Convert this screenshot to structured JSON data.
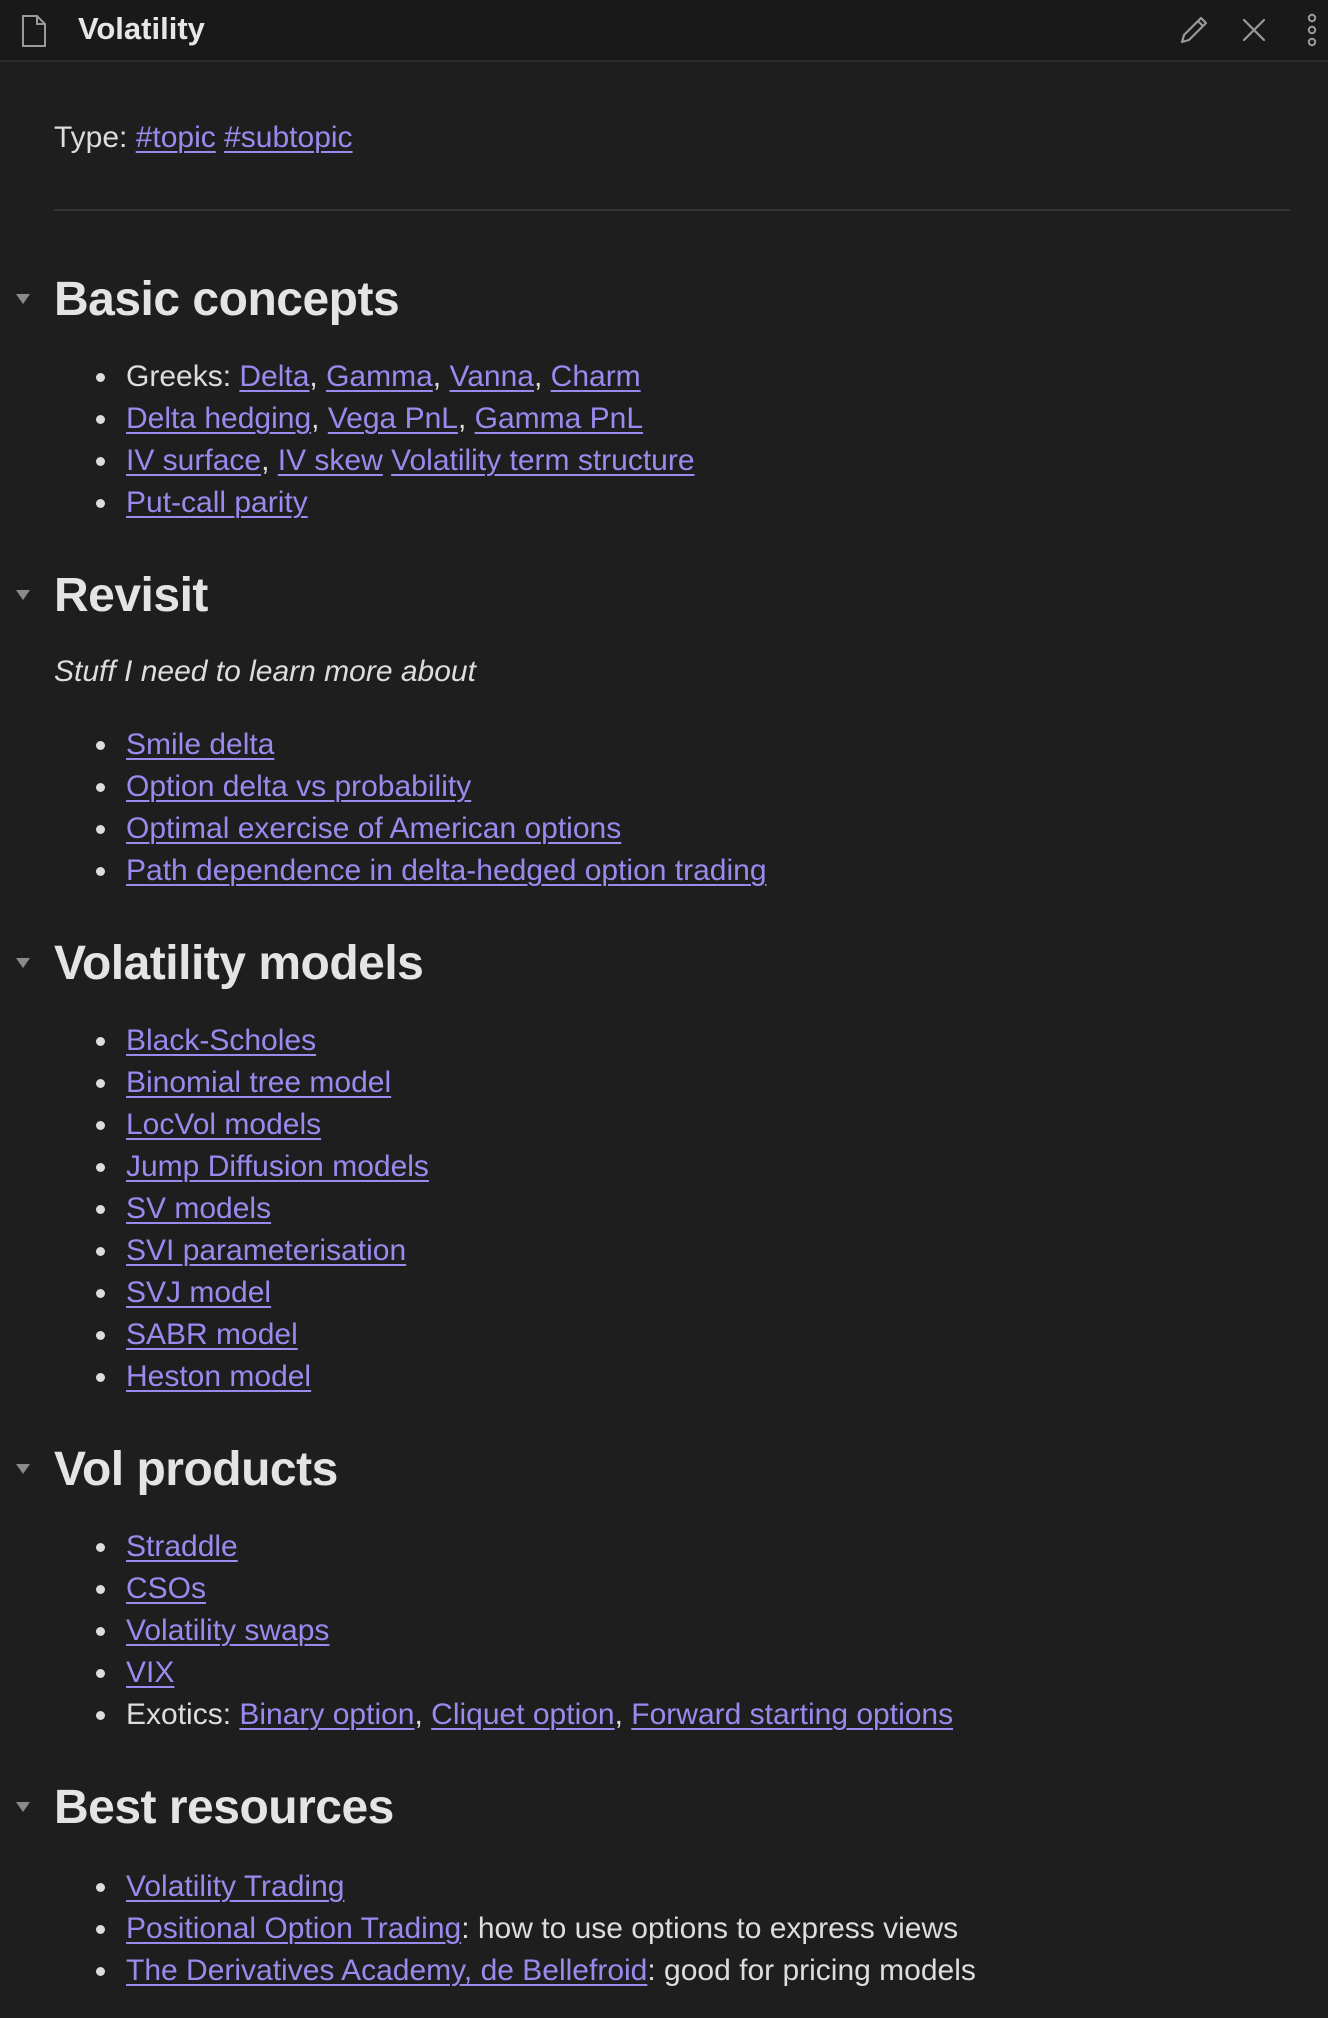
{
  "window": {
    "title": "Volatility",
    "icons": [
      "file-icon",
      "pencil-icon",
      "close-icon",
      "more-vertical-icon"
    ]
  },
  "meta": {
    "label": "Type:",
    "tags": [
      "#topic",
      "#subtopic"
    ]
  },
  "sections": {
    "basic": {
      "heading": "Basic concepts",
      "greeks_label": "Greeks:",
      "greeks": [
        "Delta",
        "Gamma",
        "Vanna",
        "Charm"
      ],
      "hedging": [
        "Delta hedging",
        "Vega PnL",
        "Gamma PnL"
      ],
      "surface": [
        "IV surface",
        "IV skew",
        "Volatility term structure"
      ],
      "parity": "Put-call parity"
    },
    "revisit": {
      "heading": "Revisit",
      "subtitle": "Stuff I need to learn more about",
      "items": [
        "Smile delta",
        "Option delta vs probability",
        "Optimal exercise of American options",
        "Path dependence in delta-hedged option trading"
      ]
    },
    "models": {
      "heading": "Volatility models",
      "items": [
        "Black-Scholes",
        "Binomial tree model",
        "LocVol models",
        "Jump Diffusion models",
        "SV models",
        "SVI parameterisation",
        "SVJ model",
        "SABR model",
        "Heston model"
      ]
    },
    "products": {
      "heading": "Vol products",
      "items": [
        "Straddle",
        "CSOs",
        "Volatility swaps",
        "VIX"
      ],
      "exotics_label": "Exotics:",
      "exotics": [
        "Binary option",
        "Cliquet option",
        "Forward starting options"
      ]
    },
    "resources": {
      "heading": "Best resources",
      "r1_link": "Volatility Trading",
      "r2_link": "Positional Option Trading",
      "r2_note": ": how to use options to express views",
      "r3_link": "The Derivatives Academy, de Bellefroid",
      "r3_note": ": good for pricing models"
    }
  },
  "colors": {
    "background": "#1e1e1e",
    "link": "#9b8aee",
    "text": "#dcddde"
  }
}
